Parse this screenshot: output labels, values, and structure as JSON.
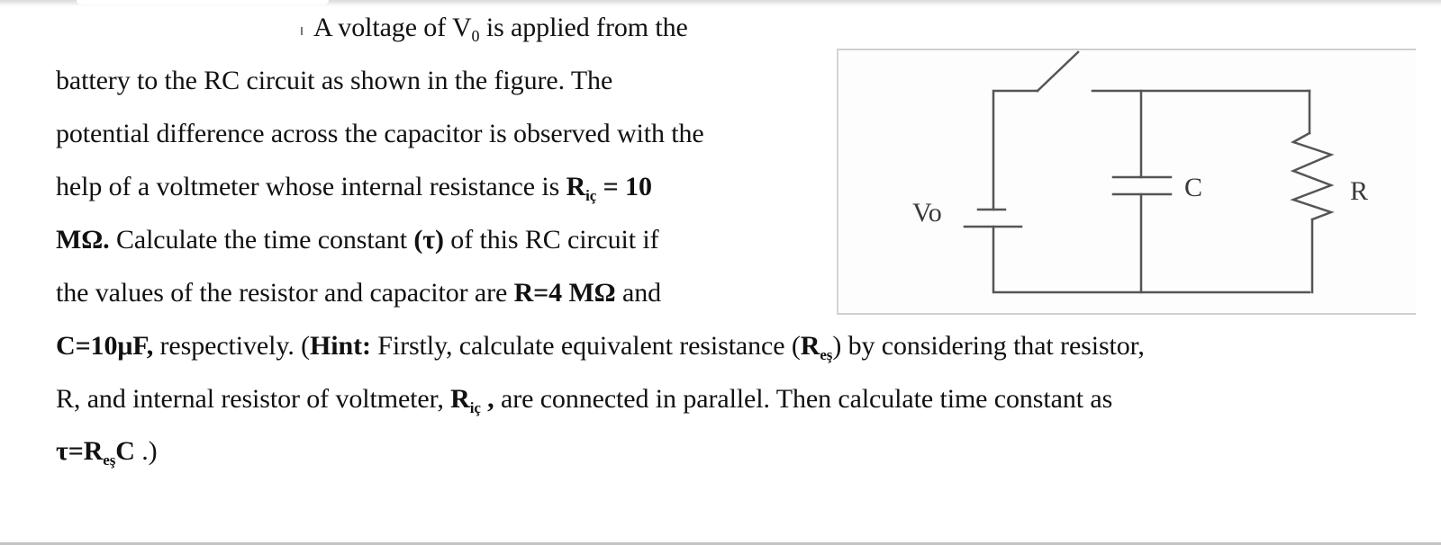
{
  "problem": {
    "line1": {
      "text": "A voltage of V",
      "sub": "0",
      "rest": " is applied from the"
    },
    "line2": "battery to the RC circuit as shown in the figure. The",
    "line3": "potential difference across the capacitor is observed with the",
    "line4": {
      "text": "help of a voltmeter whose internal resistance is ",
      "bold_R": "R",
      "bold_sub": "iç",
      "bold_rest": " = 10"
    },
    "line5": {
      "bold": "MΩ.",
      "text": " Calculate the time constant ",
      "bold_tau": "(τ)",
      "rest": " of this RC circuit if"
    },
    "line6": {
      "text": "the values of the resistor and capacitor are ",
      "bold": "R=4 MΩ",
      "rest": " and"
    },
    "line7": {
      "bold1": "C=10μF,",
      "text1": " respectively. (",
      "bold_hint": "Hint:",
      "text2": " Firstly, calculate equivalent resistance (",
      "bold_R": "R",
      "bold_sub": "eş",
      "text3": ") by considering that resistor,"
    },
    "line8": {
      "text1": "R, and internal resistor of voltmeter, ",
      "bold_R": "R",
      "bold_sub": "iç",
      "bold_comma": " ,",
      "text2": " are connected in parallel. Then calculate time constant as"
    },
    "line9": {
      "bold1": "τ=R",
      "bold_sub": "eş",
      "bold2": "C",
      "text": " .)"
    }
  },
  "figure": {
    "title": "RC circuit with switch, battery, capacitor and resistor",
    "battery_label": "Vo",
    "capacitor_label": "C",
    "resistor_label": "R",
    "switch_state": "open",
    "wire_color": "#555555"
  }
}
